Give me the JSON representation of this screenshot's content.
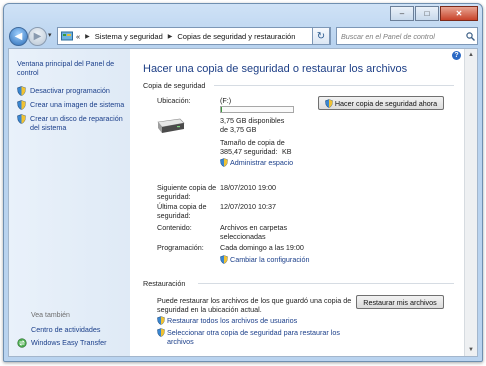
{
  "window": {
    "caption_buttons": [
      "–",
      "□",
      "✕"
    ]
  },
  "nav": {
    "back_glyph": "◀",
    "forward_glyph": "▶",
    "dropdown_glyph": "▾",
    "history_glyph": "«",
    "breadcrumbs": [
      "Sistema y seguridad",
      "Copias de seguridad y restauración"
    ],
    "separator": "▶",
    "refresh_glyph": "↻",
    "search_placeholder": "Buscar en el Panel de control"
  },
  "sidebar": {
    "home": "Ventana principal del Panel de control",
    "tasks": [
      {
        "label": "Desactivar programación",
        "icon": "shield-icon"
      },
      {
        "label": "Crear una imagen de sistema",
        "icon": "shield-icon"
      },
      {
        "label": "Crear un disco de reparación del sistema",
        "icon": "shield-icon"
      }
    ],
    "see_also": "Vea también",
    "see_also_links": [
      {
        "label": "Centro de actividades"
      },
      {
        "label": "Windows Easy Transfer",
        "icon": "transfer-icon"
      }
    ]
  },
  "main": {
    "title": "Hacer una copia de seguridad o restaurar los archivos",
    "help": "?",
    "backup": {
      "heading": "Copia de seguridad",
      "location_label": "Ubicación:",
      "location_value": "(F:)",
      "disk_usage_fraction": 0.02,
      "free_space": "3,75 GB disponibles de 3,75 GB",
      "backup_size": "Tamaño de copia de 385,47 seguridad:",
      "backup_size_unit": "KB",
      "manage_space": "Administrar espacio",
      "backup_now_button": "Hacer copia de seguridad ahora",
      "next_label": "Siguiente copia de seguridad:",
      "next_value": "18/07/2010 19:00",
      "last_label": "Última copia de seguridad:",
      "last_value": "12/07/2010 10:37",
      "contents_label": "Contenido:",
      "contents_value": "Archivos en carpetas seleccionadas",
      "schedule_label": "Programación:",
      "schedule_value": "Cada domingo a las 19:00",
      "change_settings": "Cambiar la configuración"
    },
    "restore": {
      "heading": "Restauración",
      "description": "Puede restaurar los archivos de los que guardó una copia de seguridad en la ubicación actual.",
      "restore_button": "Restaurar mis archivos",
      "restore_all_users": "Restaurar todos los archivos de usuarios",
      "select_other": "Seleccionar otra copia de seguridad para restaurar los archivos"
    }
  },
  "colors": {
    "link": "#1b3f8a",
    "title": "#1e3f86",
    "progress": "#3a9a3a",
    "sidebar_bg": "#e4eef8"
  }
}
